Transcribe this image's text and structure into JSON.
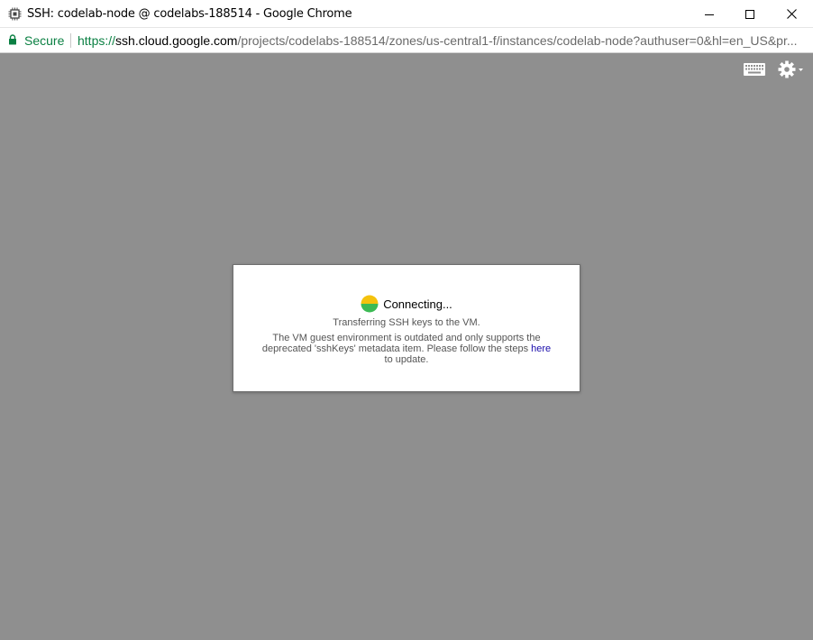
{
  "window": {
    "title": "SSH: codelab-node @ codelabs-188514 - Google Chrome",
    "app_icon": "chip-icon",
    "controls": [
      "minimize-icon",
      "maximize-icon",
      "close-icon"
    ]
  },
  "addressbar": {
    "secure_label": "Secure",
    "url_scheme": "https://",
    "url_host": "ssh.cloud.google.com",
    "url_path": "/projects/codelabs-188514/zones/us-central1-f/instances/codelab-node?authuser=0&hl=en_US&pr..."
  },
  "toolbar": {
    "icons": [
      "keyboard-icon",
      "gear-icon"
    ]
  },
  "dialog": {
    "status": "Connecting...",
    "substatus": "Transferring SSH keys to the VM.",
    "warning_text": "The VM guest environment is outdated and only supports the deprecated 'sshKeys' metadata item. Please follow the steps",
    "link_text": "here",
    "warning_suffix": "to update."
  },
  "colors": {
    "secure": "#0b8043",
    "content_bg": "#8f8f8f",
    "link": "#1a0dab",
    "spinner_yellow": "#f4c20d",
    "spinner_green": "#3cba54"
  }
}
